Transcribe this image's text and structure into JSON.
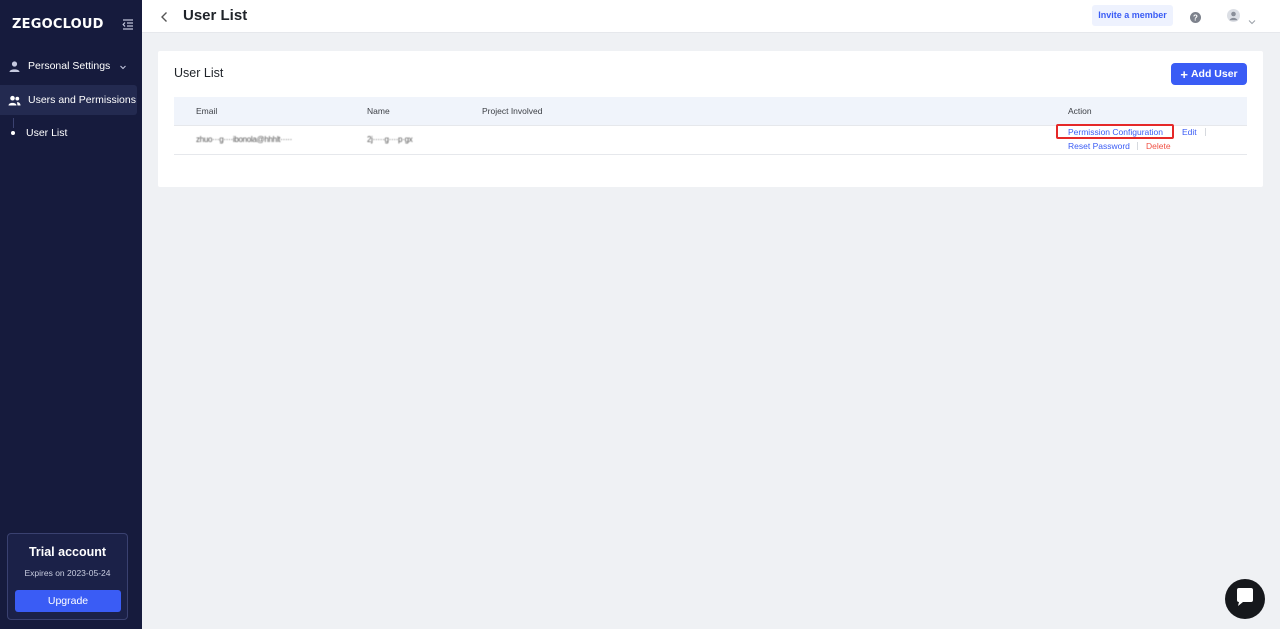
{
  "sidebar": {
    "logo": "ZEGOCLOUD",
    "items": [
      {
        "label": "Personal Settings"
      },
      {
        "label": "Users and Permissions"
      }
    ],
    "sub_items": [
      {
        "label": "User List"
      }
    ],
    "trial": {
      "title": "Trial account",
      "expires": "Expires on 2023-05-24",
      "upgrade_label": "Upgrade"
    }
  },
  "header": {
    "title": "User List",
    "invite_label": "Invite a member"
  },
  "main": {
    "card_title": "User List",
    "add_user_label": "Add User",
    "table": {
      "columns": [
        "Email",
        "Name",
        "Project Involved",
        "Action"
      ],
      "rows": [
        {
          "email": "zhuo···g····ibonola@hhhlt·····",
          "name": "2j·····g····p·gx",
          "project": "",
          "actions": {
            "permission": "Permission Configuration",
            "edit": "Edit",
            "reset": "Reset Password",
            "delete": "Delete"
          }
        }
      ]
    }
  },
  "colors": {
    "sidebar_bg": "#161b3d",
    "accent": "#3a5cf5",
    "danger": "#f05245",
    "highlight": "#e52828"
  }
}
